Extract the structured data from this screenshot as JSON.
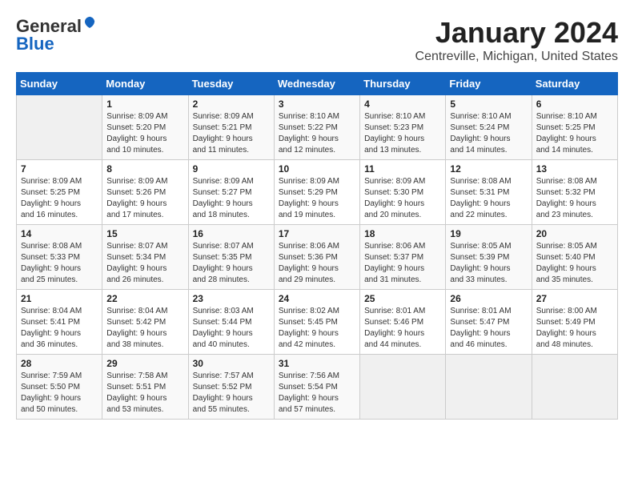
{
  "header": {
    "logo_general": "General",
    "logo_blue": "Blue",
    "title": "January 2024",
    "location": "Centreville, Michigan, United States"
  },
  "days_of_week": [
    "Sunday",
    "Monday",
    "Tuesday",
    "Wednesday",
    "Thursday",
    "Friday",
    "Saturday"
  ],
  "weeks": [
    [
      {
        "day": "",
        "sunrise": "",
        "sunset": "",
        "daylight": ""
      },
      {
        "day": "1",
        "sunrise": "Sunrise: 8:09 AM",
        "sunset": "Sunset: 5:20 PM",
        "daylight": "Daylight: 9 hours and 10 minutes."
      },
      {
        "day": "2",
        "sunrise": "Sunrise: 8:09 AM",
        "sunset": "Sunset: 5:21 PM",
        "daylight": "Daylight: 9 hours and 11 minutes."
      },
      {
        "day": "3",
        "sunrise": "Sunrise: 8:10 AM",
        "sunset": "Sunset: 5:22 PM",
        "daylight": "Daylight: 9 hours and 12 minutes."
      },
      {
        "day": "4",
        "sunrise": "Sunrise: 8:10 AM",
        "sunset": "Sunset: 5:23 PM",
        "daylight": "Daylight: 9 hours and 13 minutes."
      },
      {
        "day": "5",
        "sunrise": "Sunrise: 8:10 AM",
        "sunset": "Sunset: 5:24 PM",
        "daylight": "Daylight: 9 hours and 14 minutes."
      },
      {
        "day": "6",
        "sunrise": "Sunrise: 8:10 AM",
        "sunset": "Sunset: 5:25 PM",
        "daylight": "Daylight: 9 hours and 14 minutes."
      }
    ],
    [
      {
        "day": "7",
        "sunrise": "Sunrise: 8:09 AM",
        "sunset": "Sunset: 5:25 PM",
        "daylight": "Daylight: 9 hours and 16 minutes."
      },
      {
        "day": "8",
        "sunrise": "Sunrise: 8:09 AM",
        "sunset": "Sunset: 5:26 PM",
        "daylight": "Daylight: 9 hours and 17 minutes."
      },
      {
        "day": "9",
        "sunrise": "Sunrise: 8:09 AM",
        "sunset": "Sunset: 5:27 PM",
        "daylight": "Daylight: 9 hours and 18 minutes."
      },
      {
        "day": "10",
        "sunrise": "Sunrise: 8:09 AM",
        "sunset": "Sunset: 5:29 PM",
        "daylight": "Daylight: 9 hours and 19 minutes."
      },
      {
        "day": "11",
        "sunrise": "Sunrise: 8:09 AM",
        "sunset": "Sunset: 5:30 PM",
        "daylight": "Daylight: 9 hours and 20 minutes."
      },
      {
        "day": "12",
        "sunrise": "Sunrise: 8:08 AM",
        "sunset": "Sunset: 5:31 PM",
        "daylight": "Daylight: 9 hours and 22 minutes."
      },
      {
        "day": "13",
        "sunrise": "Sunrise: 8:08 AM",
        "sunset": "Sunset: 5:32 PM",
        "daylight": "Daylight: 9 hours and 23 minutes."
      }
    ],
    [
      {
        "day": "14",
        "sunrise": "Sunrise: 8:08 AM",
        "sunset": "Sunset: 5:33 PM",
        "daylight": "Daylight: 9 hours and 25 minutes."
      },
      {
        "day": "15",
        "sunrise": "Sunrise: 8:07 AM",
        "sunset": "Sunset: 5:34 PM",
        "daylight": "Daylight: 9 hours and 26 minutes."
      },
      {
        "day": "16",
        "sunrise": "Sunrise: 8:07 AM",
        "sunset": "Sunset: 5:35 PM",
        "daylight": "Daylight: 9 hours and 28 minutes."
      },
      {
        "day": "17",
        "sunrise": "Sunrise: 8:06 AM",
        "sunset": "Sunset: 5:36 PM",
        "daylight": "Daylight: 9 hours and 29 minutes."
      },
      {
        "day": "18",
        "sunrise": "Sunrise: 8:06 AM",
        "sunset": "Sunset: 5:37 PM",
        "daylight": "Daylight: 9 hours and 31 minutes."
      },
      {
        "day": "19",
        "sunrise": "Sunrise: 8:05 AM",
        "sunset": "Sunset: 5:39 PM",
        "daylight": "Daylight: 9 hours and 33 minutes."
      },
      {
        "day": "20",
        "sunrise": "Sunrise: 8:05 AM",
        "sunset": "Sunset: 5:40 PM",
        "daylight": "Daylight: 9 hours and 35 minutes."
      }
    ],
    [
      {
        "day": "21",
        "sunrise": "Sunrise: 8:04 AM",
        "sunset": "Sunset: 5:41 PM",
        "daylight": "Daylight: 9 hours and 36 minutes."
      },
      {
        "day": "22",
        "sunrise": "Sunrise: 8:04 AM",
        "sunset": "Sunset: 5:42 PM",
        "daylight": "Daylight: 9 hours and 38 minutes."
      },
      {
        "day": "23",
        "sunrise": "Sunrise: 8:03 AM",
        "sunset": "Sunset: 5:44 PM",
        "daylight": "Daylight: 9 hours and 40 minutes."
      },
      {
        "day": "24",
        "sunrise": "Sunrise: 8:02 AM",
        "sunset": "Sunset: 5:45 PM",
        "daylight": "Daylight: 9 hours and 42 minutes."
      },
      {
        "day": "25",
        "sunrise": "Sunrise: 8:01 AM",
        "sunset": "Sunset: 5:46 PM",
        "daylight": "Daylight: 9 hours and 44 minutes."
      },
      {
        "day": "26",
        "sunrise": "Sunrise: 8:01 AM",
        "sunset": "Sunset: 5:47 PM",
        "daylight": "Daylight: 9 hours and 46 minutes."
      },
      {
        "day": "27",
        "sunrise": "Sunrise: 8:00 AM",
        "sunset": "Sunset: 5:49 PM",
        "daylight": "Daylight: 9 hours and 48 minutes."
      }
    ],
    [
      {
        "day": "28",
        "sunrise": "Sunrise: 7:59 AM",
        "sunset": "Sunset: 5:50 PM",
        "daylight": "Daylight: 9 hours and 50 minutes."
      },
      {
        "day": "29",
        "sunrise": "Sunrise: 7:58 AM",
        "sunset": "Sunset: 5:51 PM",
        "daylight": "Daylight: 9 hours and 53 minutes."
      },
      {
        "day": "30",
        "sunrise": "Sunrise: 7:57 AM",
        "sunset": "Sunset: 5:52 PM",
        "daylight": "Daylight: 9 hours and 55 minutes."
      },
      {
        "day": "31",
        "sunrise": "Sunrise: 7:56 AM",
        "sunset": "Sunset: 5:54 PM",
        "daylight": "Daylight: 9 hours and 57 minutes."
      },
      {
        "day": "",
        "sunrise": "",
        "sunset": "",
        "daylight": ""
      },
      {
        "day": "",
        "sunrise": "",
        "sunset": "",
        "daylight": ""
      },
      {
        "day": "",
        "sunrise": "",
        "sunset": "",
        "daylight": ""
      }
    ]
  ]
}
